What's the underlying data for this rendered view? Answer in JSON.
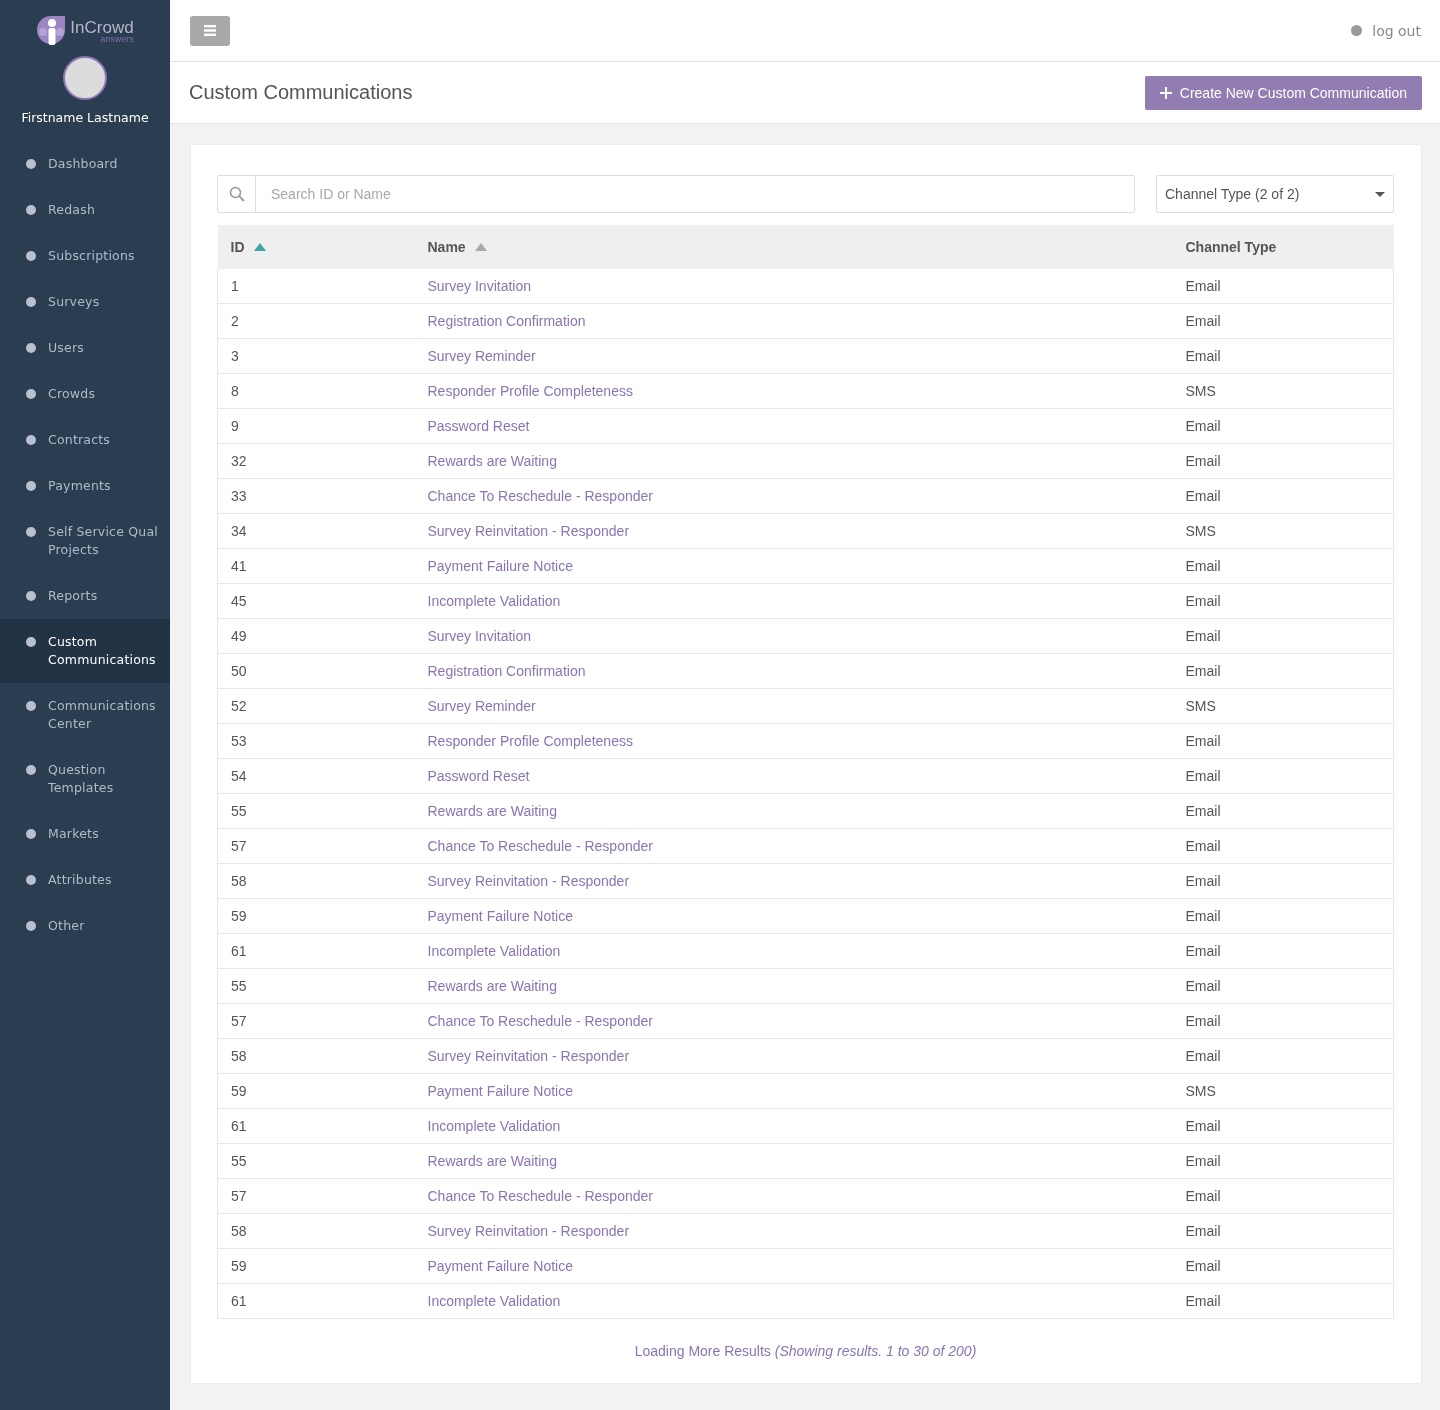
{
  "sidebar": {
    "logo": {
      "name": "InCrowd",
      "tagline": "answers"
    },
    "user": "Firstname Lastname",
    "items": [
      {
        "label": "Dashboard",
        "selected": false
      },
      {
        "label": "Redash",
        "selected": false
      },
      {
        "label": "Subscriptions",
        "selected": false
      },
      {
        "label": "Surveys",
        "selected": false
      },
      {
        "label": "Users",
        "selected": false
      },
      {
        "label": "Crowds",
        "selected": false
      },
      {
        "label": "Contracts",
        "selected": false
      },
      {
        "label": "Payments",
        "selected": false
      },
      {
        "label": "Self Service Qual Projects",
        "selected": false
      },
      {
        "label": "Reports",
        "selected": false
      },
      {
        "label": "Custom Communications",
        "selected": true
      },
      {
        "label": "Communications Center",
        "selected": false
      },
      {
        "label": "Question Templates",
        "selected": false
      },
      {
        "label": "Markets",
        "selected": false
      },
      {
        "label": "Attributes",
        "selected": false
      },
      {
        "label": "Other",
        "selected": false
      }
    ]
  },
  "topbar": {
    "logout": "log out"
  },
  "page": {
    "title": "Custom Communications",
    "create_button": "Create New Custom Communication"
  },
  "search": {
    "placeholder": "Search ID or Name"
  },
  "filter": {
    "value": "Channel Type (2 of 2)"
  },
  "table": {
    "columns": [
      {
        "label": "ID",
        "kind": "sortable",
        "selected": true
      },
      {
        "label": "Name",
        "kind": "sortable",
        "selected": false
      },
      {
        "label": "Channel Type",
        "kind": "plain"
      }
    ],
    "rows": [
      {
        "id": "1",
        "name": "Survey Invitation",
        "channel": "Email"
      },
      {
        "id": "2",
        "name": "Registration Confirmation",
        "channel": "Email"
      },
      {
        "id": "3",
        "name": "Survey Reminder",
        "channel": "Email"
      },
      {
        "id": "8",
        "name": "Responder Profile Completeness",
        "channel": "SMS"
      },
      {
        "id": "9",
        "name": "Password Reset",
        "channel": "Email"
      },
      {
        "id": "32",
        "name": "Rewards are Waiting",
        "channel": "Email"
      },
      {
        "id": "33",
        "name": "Chance To Reschedule - Responder",
        "channel": "Email"
      },
      {
        "id": "34",
        "name": "Survey Reinvitation - Responder",
        "channel": "SMS"
      },
      {
        "id": "41",
        "name": "Payment Failure Notice",
        "channel": "Email"
      },
      {
        "id": "45",
        "name": "Incomplete Validation",
        "channel": "Email"
      },
      {
        "id": "49",
        "name": "Survey Invitation",
        "channel": "Email"
      },
      {
        "id": "50",
        "name": "Registration Confirmation",
        "channel": "Email"
      },
      {
        "id": "52",
        "name": "Survey Reminder",
        "channel": "SMS"
      },
      {
        "id": "53",
        "name": "Responder Profile Completeness",
        "channel": "Email"
      },
      {
        "id": "54",
        "name": "Password Reset",
        "channel": "Email"
      },
      {
        "id": "55",
        "name": "Rewards are Waiting",
        "channel": "Email"
      },
      {
        "id": "57",
        "name": "Chance To Reschedule - Responder",
        "channel": "Email"
      },
      {
        "id": "58",
        "name": "Survey Reinvitation - Responder",
        "channel": "Email"
      },
      {
        "id": "59",
        "name": "Payment Failure Notice",
        "channel": "Email"
      },
      {
        "id": "61",
        "name": "Incomplete Validation",
        "channel": "Email"
      },
      {
        "id": "55",
        "name": "Rewards are Waiting",
        "channel": "Email"
      },
      {
        "id": "57",
        "name": "Chance To Reschedule - Responder",
        "channel": "Email"
      },
      {
        "id": "58",
        "name": "Survey Reinvitation - Responder",
        "channel": "Email"
      },
      {
        "id": "59",
        "name": "Payment Failure Notice",
        "channel": "SMS"
      },
      {
        "id": "61",
        "name": "Incomplete Validation",
        "channel": "Email"
      },
      {
        "id": "55",
        "name": "Rewards are Waiting",
        "channel": "Email"
      },
      {
        "id": "57",
        "name": "Chance To Reschedule - Responder",
        "channel": "Email"
      },
      {
        "id": "58",
        "name": "Survey Reinvitation - Responder",
        "channel": "Email"
      },
      {
        "id": "59",
        "name": "Payment Failure Notice",
        "channel": "Email"
      },
      {
        "id": "61",
        "name": "Incomplete Validation",
        "channel": "Email"
      }
    ]
  },
  "footer": "Loading More Results *(Showing results. 1 to 30 of 200)*"
}
